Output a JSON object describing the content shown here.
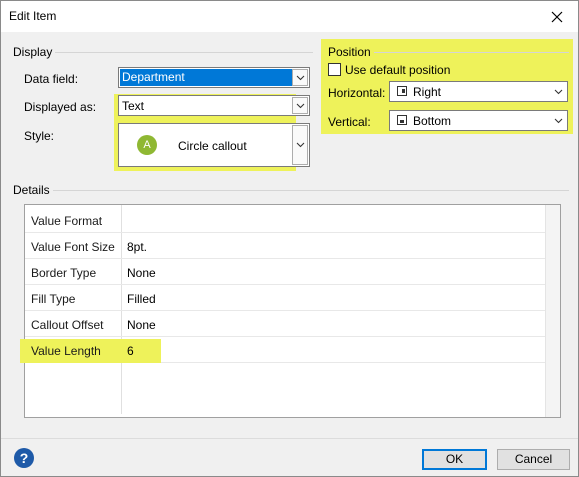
{
  "window": {
    "title": "Edit Item"
  },
  "display": {
    "group_label": "Display",
    "data_field_label": "Data field:",
    "data_field_value": "Department",
    "displayed_as_label": "Displayed as:",
    "displayed_as_value": "Text",
    "style_label": "Style:",
    "style_badge": "A",
    "style_value": "Circle callout"
  },
  "position": {
    "group_label": "Position",
    "use_default_label": "Use default position",
    "use_default_checked": false,
    "horizontal_label": "Horizontal:",
    "horizontal_value": "Right",
    "vertical_label": "Vertical:",
    "vertical_value": "Bottom"
  },
  "details": {
    "group_label": "Details",
    "rows": [
      {
        "label": "Value Format",
        "value": ""
      },
      {
        "label": "Value Font Size",
        "value": "8pt."
      },
      {
        "label": "Border Type",
        "value": "None"
      },
      {
        "label": "Fill Type",
        "value": "Filled"
      },
      {
        "label": "Callout Offset",
        "value": "None"
      },
      {
        "label": "Value Length",
        "value": "6"
      }
    ]
  },
  "buttons": {
    "ok": "OK",
    "cancel": "Cancel",
    "help": "?"
  },
  "colors": {
    "highlight": "#eef25a",
    "selection": "#0078d7",
    "badge": "#8fb833"
  }
}
